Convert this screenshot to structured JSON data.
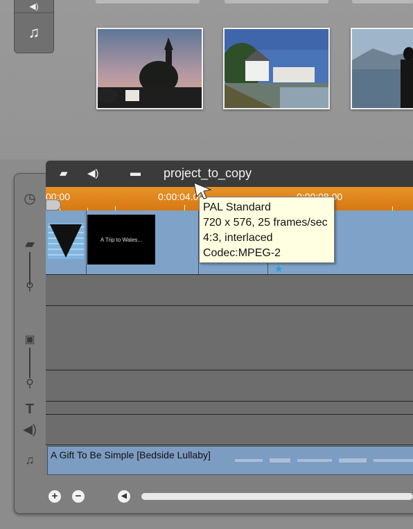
{
  "library": {
    "music_tab_icon": "music-note-icon",
    "thumbnails": [
      "thumbnail-castle-dusk",
      "thumbnail-harbor-village",
      "thumbnail-lake-photographer"
    ]
  },
  "timeline": {
    "project_name": "project_to_copy",
    "ruler": {
      "labels": [
        "00:00",
        "0:00:04.00",
        "0:00:08.00"
      ]
    },
    "video_clip_title": "A Trip to Wales...",
    "audio_clip_label": "A Gift To Be Simple [Bedside Lullaby]"
  },
  "tooltip": {
    "line1": "PAL Standard",
    "line2": "720 x 576, 25 frames/sec",
    "line3": "4:3, interlaced",
    "line4": "Codec:MPEG-2"
  },
  "colors": {
    "ruler": "#e08520",
    "video_track": "#7fa3c8",
    "tooltip_bg": "#ffffe1",
    "header_bg": "#3b3b3b"
  }
}
